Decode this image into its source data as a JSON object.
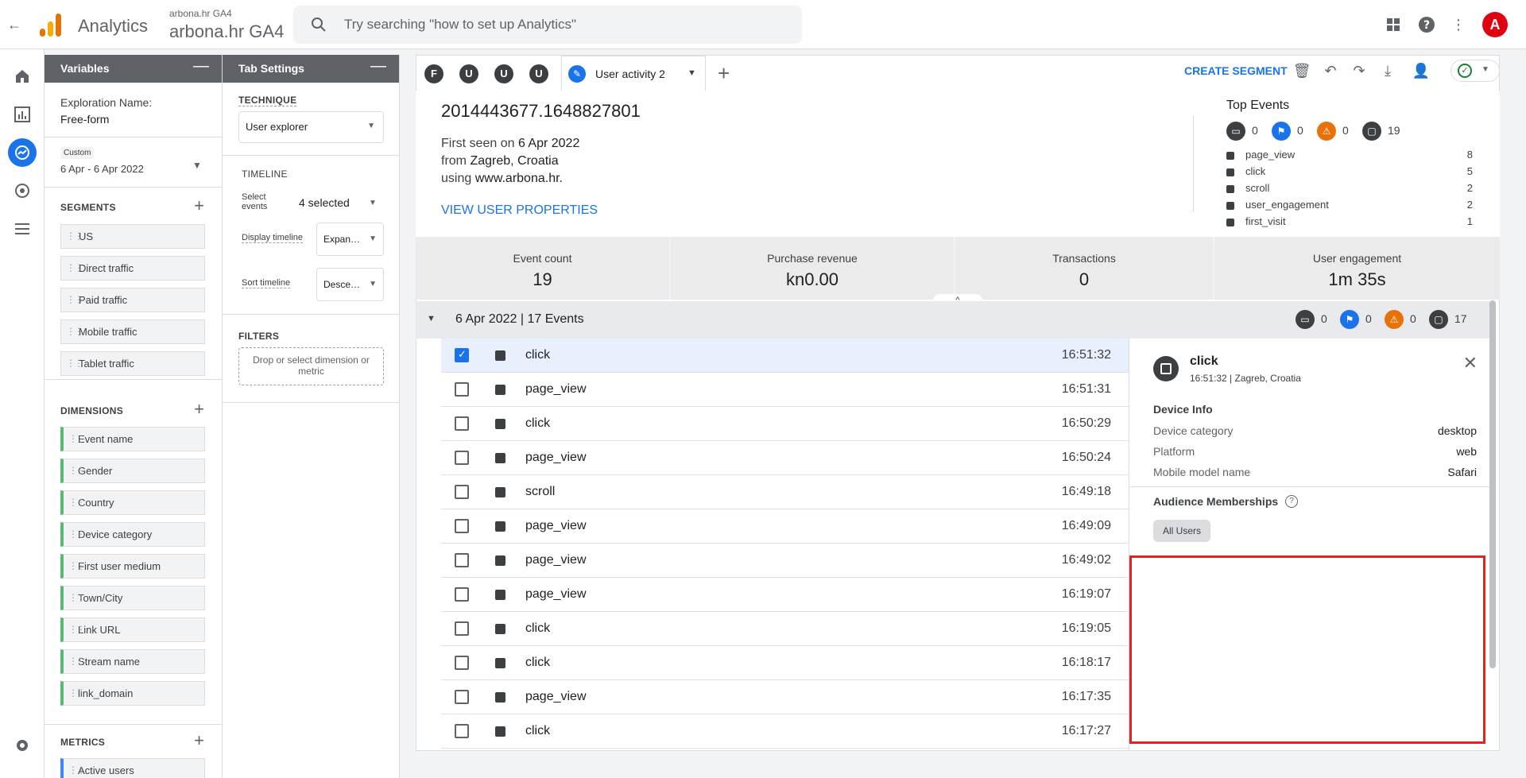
{
  "topbar": {
    "app_name": "Analytics",
    "property_small": "arbona.hr GA4",
    "property_big": "arbona.hr GA4",
    "search_placeholder": "Try searching \"how to set up Analytics\"",
    "avatar_letter": "A"
  },
  "variables": {
    "header": "Variables",
    "exploration_label": "Exploration Name:",
    "exploration_value": "Free-form",
    "date_badge": "Custom",
    "date_range": "6 Apr - 6 Apr 2022",
    "segments_label": "SEGMENTS",
    "segments": [
      "US",
      "Direct traffic",
      "Paid traffic",
      "Mobile traffic",
      "Tablet traffic"
    ],
    "dimensions_label": "DIMENSIONS",
    "dimensions": [
      "Event name",
      "Gender",
      "Country",
      "Device category",
      "First user medium",
      "Town/City",
      "Link URL",
      "Stream name",
      "link_domain"
    ],
    "metrics_label": "METRICS",
    "metrics": [
      "Active users"
    ]
  },
  "tab_settings": {
    "header": "Tab Settings",
    "technique_label": "TECHNIQUE",
    "technique_value": "User explorer",
    "timeline_label": "TIMELINE",
    "select_events_label": "Select events",
    "select_events_value": "4 selected",
    "display_timeline_label": "Display timeline",
    "display_timeline_value": "Expan…",
    "sort_timeline_label": "Sort timeline",
    "sort_timeline_value": "Desce…",
    "filters_label": "FILTERS",
    "filters_drop": "Drop or select dimension or metric"
  },
  "tabs": {
    "circles": [
      "F",
      "U",
      "U",
      "U"
    ],
    "active_label": "User activity 2",
    "create_segment": "CREATE SEGMENT"
  },
  "user": {
    "id": "2014443677.1648827801",
    "first_seen_prefix": "First seen on ",
    "first_seen_date": "6 Apr 2022",
    "from_prefix": "from ",
    "from_value": "Zagreb, Croatia",
    "using_prefix": "using ",
    "using_value": "www.arbona.hr.",
    "view_props": "VIEW USER PROPERTIES"
  },
  "top_events": {
    "title": "Top Events",
    "counts": [
      "0",
      "0",
      "0",
      "19"
    ],
    "list": [
      {
        "name": "page_view",
        "count": "8"
      },
      {
        "name": "click",
        "count": "5"
      },
      {
        "name": "scroll",
        "count": "2"
      },
      {
        "name": "user_engagement",
        "count": "2"
      },
      {
        "name": "first_visit",
        "count": "1"
      }
    ]
  },
  "metrics": [
    {
      "label": "Event count",
      "value": "19"
    },
    {
      "label": "Purchase revenue",
      "value": "kn0.00"
    },
    {
      "label": "Transactions",
      "value": "0"
    },
    {
      "label": "User engagement",
      "value": "1m 35s"
    }
  ],
  "datebar": {
    "title": "6 Apr 2022 | 17 Events",
    "counts": [
      "0",
      "0",
      "0",
      "17"
    ]
  },
  "events": [
    {
      "name": "click",
      "time": "16:51:32",
      "checked": true
    },
    {
      "name": "page_view",
      "time": "16:51:31",
      "checked": false
    },
    {
      "name": "click",
      "time": "16:50:29",
      "checked": false
    },
    {
      "name": "page_view",
      "time": "16:50:24",
      "checked": false
    },
    {
      "name": "scroll",
      "time": "16:49:18",
      "checked": false
    },
    {
      "name": "page_view",
      "time": "16:49:09",
      "checked": false
    },
    {
      "name": "page_view",
      "time": "16:49:02",
      "checked": false
    },
    {
      "name": "page_view",
      "time": "16:19:07",
      "checked": false
    },
    {
      "name": "click",
      "time": "16:19:05",
      "checked": false
    },
    {
      "name": "click",
      "time": "16:18:17",
      "checked": false
    },
    {
      "name": "page_view",
      "time": "16:17:35",
      "checked": false
    },
    {
      "name": "click",
      "time": "16:17:27",
      "checked": false
    }
  ],
  "detail": {
    "title": "click",
    "subtitle": "16:51:32 | Zagreb, Croatia",
    "device_info": "Device Info",
    "rows": [
      {
        "k": "Device category",
        "v": "desktop"
      },
      {
        "k": "Platform",
        "v": "web"
      },
      {
        "k": "Mobile model name",
        "v": "Safari"
      }
    ],
    "audience": "Audience Memberships",
    "audience_chip": "All Users"
  }
}
